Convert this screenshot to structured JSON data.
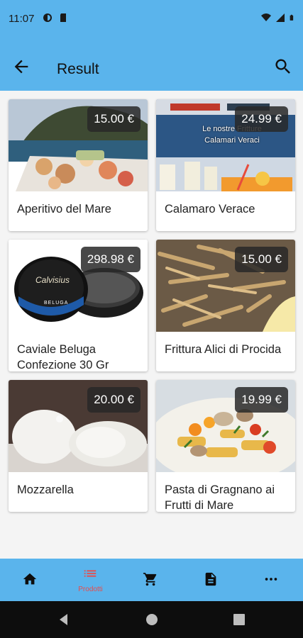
{
  "status": {
    "time": "11:07"
  },
  "app_bar": {
    "title": "Result"
  },
  "products": [
    {
      "name": "Aperitivo del Mare",
      "price": "15.00 €"
    },
    {
      "name": "Calamaro Verace",
      "price": "24.99 €",
      "overlay_text": "Le nostre Fritture\nCalamari Veraci"
    },
    {
      "name": "Caviale Beluga Confezione 30 Gr",
      "price": "298.98 €",
      "tin_brand": "Calvisius",
      "tin_label": "BELUGA"
    },
    {
      "name": "Frittura Alici di Procida",
      "price": "15.00 €"
    },
    {
      "name": "Mozzarella",
      "price": "20.00 €"
    },
    {
      "name": "Pasta di Gragnano ai Frutti di Mare",
      "price": "19.99 €"
    }
  ],
  "bottom_nav": {
    "items": [
      {
        "icon": "home-icon",
        "label": ""
      },
      {
        "icon": "list-icon",
        "label": "Prodotti"
      },
      {
        "icon": "cart-icon",
        "label": ""
      },
      {
        "icon": "document-icon",
        "label": ""
      },
      {
        "icon": "more-icon",
        "label": ""
      }
    ],
    "active_color": "#e84b4b"
  },
  "colors": {
    "primary": "#5ab4ec",
    "price_badge": "#282828"
  }
}
